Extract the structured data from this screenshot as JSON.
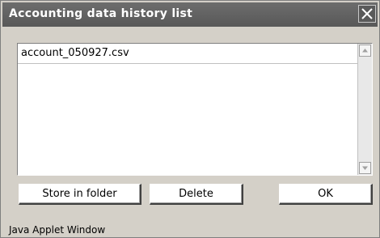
{
  "window": {
    "title": "Accounting data history list",
    "close_icon": "close-icon"
  },
  "history_list": {
    "items": [
      {
        "label": "account_050927.csv"
      }
    ]
  },
  "buttons": {
    "store_label": "Store in folder",
    "delete_label": "Delete",
    "ok_label": "OK"
  },
  "status": {
    "text": "Java Applet Window"
  },
  "colors": {
    "titlebar": "#5f5f5f",
    "window_bg": "#d4d0c8",
    "list_bg": "#ffffff"
  }
}
